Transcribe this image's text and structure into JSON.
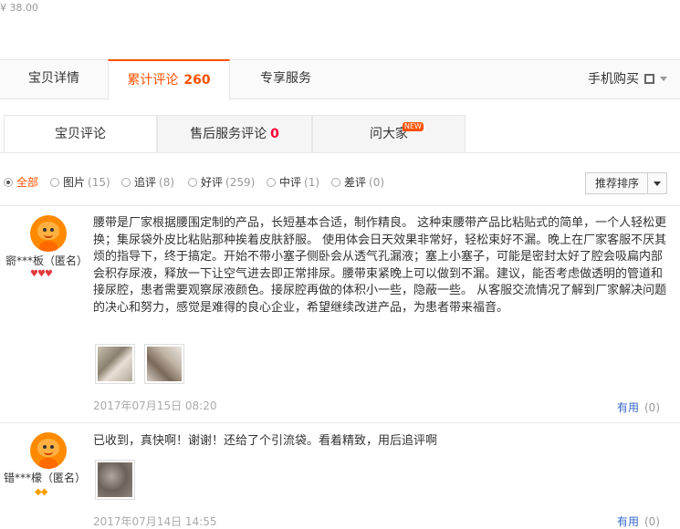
{
  "price": "¥ 38.00",
  "main_tabs": [
    {
      "label": "宝贝详情"
    },
    {
      "label": "累计评论",
      "count": "260"
    },
    {
      "label": "专享服务"
    }
  ],
  "mobile_buy": "手机购买",
  "sub_tabs": [
    {
      "label": "宝贝评论"
    },
    {
      "label": "售后服务评论",
      "count": "0"
    },
    {
      "label": "问大家",
      "badge": "NEW"
    }
  ],
  "filters": [
    {
      "label": "全部",
      "count": ""
    },
    {
      "label": "图片",
      "count": "(15)"
    },
    {
      "label": "追评",
      "count": "(8)"
    },
    {
      "label": "好评",
      "count": "(259)"
    },
    {
      "label": "中评",
      "count": "(1)"
    },
    {
      "label": "差评",
      "count": "(0)"
    }
  ],
  "sort_label": "推荐排序",
  "reviews": [
    {
      "user": "窬***板（匿名）",
      "text": "腰带是厂家根据腰围定制的产品，长短基本合适，制作精良。 这种束腰带产品比粘贴式的简单，一个人轻松更换；集尿袋外皮比粘贴那种挨着皮肤舒服。 使用体会日天效果非常好，轻松束好不漏。晚上在厂家客服不厌其烦的指导下，终于搞定。开始不带小塞子侧卧会从透气孔漏液；塞上小塞子，可能是密封太好了腔会吸扁内部会积存尿液，释放一下让空气进去即正常排尿。腰带束紧晚上可以做到不漏。建议，能否考虑做透明的管道和接尿腔，患者需要观察尿液颜色。接尿腔再做的体积小一些，隐蔽一些。 从客服交流情况了解到厂家解决问题的决心和努力，感觉是难得的良心企业，希望继续改进产品，为患者带来福音。",
      "date": "2017年07月15日 08:20",
      "useful": "有用",
      "useful_count": "(0)"
    },
    {
      "user": "错***檬（匿名）",
      "text": "已收到，真快啊！谢谢！还给了个引流袋。看着精致，用后追评啊",
      "date": "2017年07月14日 14:55",
      "useful": "有用",
      "useful_count": "(0)"
    }
  ]
}
